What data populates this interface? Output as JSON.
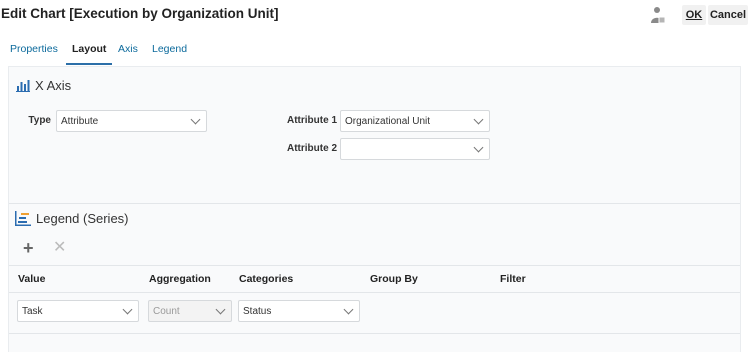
{
  "header": {
    "title": "Edit Chart [Execution by Organization Unit]",
    "ok_label": "OK",
    "cancel_label": "Cancel"
  },
  "tabs": [
    {
      "label": "Properties",
      "active": false
    },
    {
      "label": "Layout",
      "active": true
    },
    {
      "label": "Axis",
      "active": false
    },
    {
      "label": "Legend",
      "active": false
    }
  ],
  "x_axis": {
    "heading": "X Axis",
    "type_label": "Type",
    "type_value": "Attribute",
    "attribute1_label": "Attribute 1",
    "attribute1_value": "Organizational Unit",
    "attribute2_label": "Attribute 2",
    "attribute2_value": ""
  },
  "legend": {
    "heading": "Legend (Series)",
    "columns": [
      "Value",
      "Aggregation",
      "Categories",
      "Group By",
      "Filter"
    ],
    "row": {
      "value": "Task",
      "aggregation": "Count",
      "categories": "Status"
    }
  },
  "colors": {
    "tab_link": "#0c6a9c",
    "active_underline": "#2c6fa8",
    "icon_blue": "#2b6cb0",
    "panel_bg": "#f9fafb"
  },
  "icons": [
    "person-icon",
    "bar-chart-icon",
    "legend-series-icon",
    "plus-icon",
    "x-icon",
    "chevron-down-icon"
  ]
}
